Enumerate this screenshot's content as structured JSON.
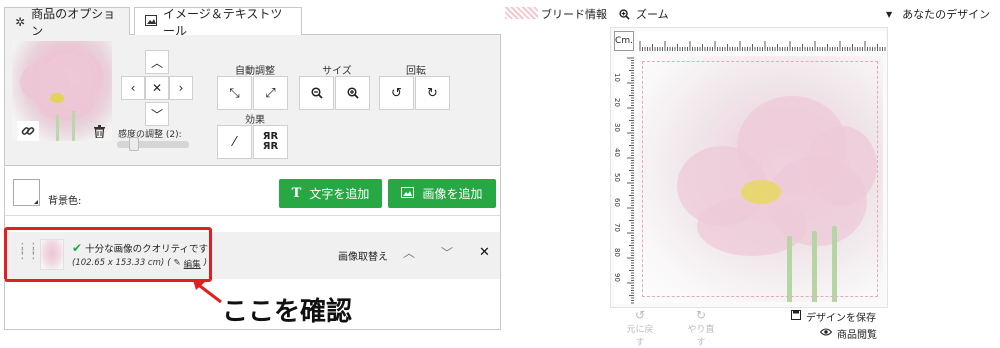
{
  "tabs": [
    {
      "label": "商品のオプション",
      "icon": "gear-icon"
    },
    {
      "label": "イメージ＆テキストツール",
      "icon": "image-icon"
    }
  ],
  "image_tools": {
    "auto_adjust_label": "自動調整",
    "size_label": "サイズ",
    "rotate_label": "回転",
    "effects_label": "効果",
    "sensitivity_label": "感度の調整 (2):",
    "sensitivity_value": 2,
    "sensitivity_fraction": 0.18
  },
  "background": {
    "label": "背景色:",
    "add_text_label": "文字を追加",
    "add_image_label": "画像を追加",
    "button_color": "#28a745"
  },
  "layer_item": {
    "quality_text": "十分な画像のクオリティです",
    "dimensions": "(102.65 x 153.33 cm)",
    "paren_open": "(",
    "paren_close": ")",
    "edit_label": "編集",
    "replace_label": "画像取替え"
  },
  "annotation": {
    "text": "ここを確認",
    "color": "#e02020"
  },
  "preview": {
    "bleed_label": "ブリード情報",
    "zoom_label": "ズーム",
    "design_label": "あなたのデザイン",
    "unit_label": "Cm.",
    "ruler_numbers": [
      "10",
      "20",
      "30",
      "40",
      "50",
      "60",
      "70",
      "80",
      "90"
    ],
    "undo_label": "元に戻す",
    "redo_label": "やり直す",
    "save_label": "デザインを保存",
    "preview_label": "商品閲覧"
  }
}
